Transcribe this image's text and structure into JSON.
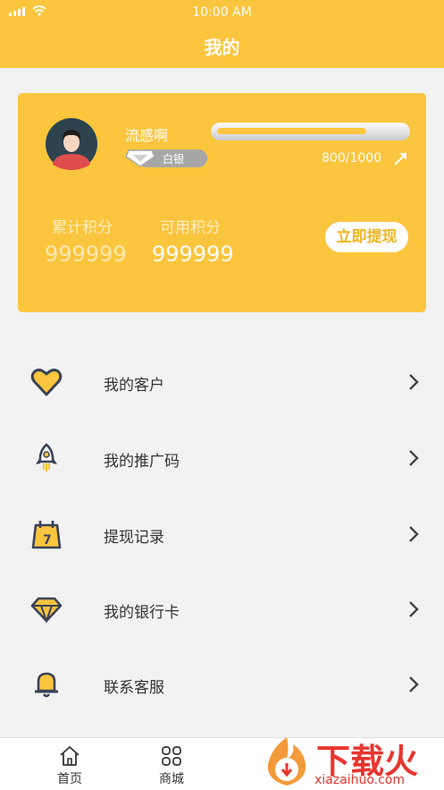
{
  "status_bar": {
    "time": "10:00 AM"
  },
  "header": {
    "title": "我的"
  },
  "profile": {
    "username": "流感啊",
    "badge_label": "白银",
    "progress_text": "800/1000",
    "progress_fraction": 0.8,
    "points_total_label": "累计积分",
    "points_total_value": "999999",
    "points_available_label": "可用积分",
    "points_available_value": "999999",
    "withdraw_label": "立即提现"
  },
  "menu": [
    {
      "label": "我的客户",
      "icon": "heart-icon"
    },
    {
      "label": "我的推广码",
      "icon": "rocket-icon"
    },
    {
      "label": "提现记录",
      "icon": "calendar-icon"
    },
    {
      "label": "我的银行卡",
      "icon": "diamond-icon"
    },
    {
      "label": "联系客服",
      "icon": "bell-icon"
    }
  ],
  "tabbar": [
    {
      "label": "首页",
      "icon": "home-icon"
    },
    {
      "label": "商城",
      "icon": "grid-icon"
    }
  ],
  "watermark": {
    "text": "下载火",
    "domain": "xiazaihuo.com"
  },
  "colors": {
    "accent": "#fbc53d",
    "icon_dark": "#3a4257",
    "watermark_red": "#e8352e"
  }
}
